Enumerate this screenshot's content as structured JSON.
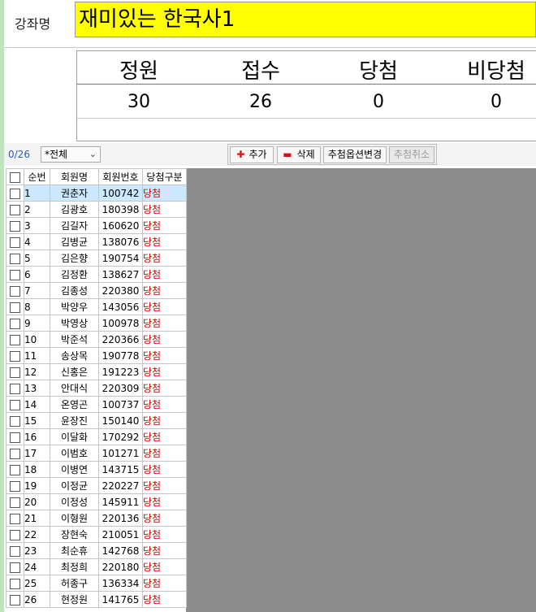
{
  "header": {
    "course_label": "강좌명",
    "course_name": "재미있는 한국사1"
  },
  "stats": {
    "headers": [
      "정원",
      "접수",
      "당첨",
      "비당첨"
    ],
    "values": [
      "30",
      "26",
      "0",
      "0"
    ]
  },
  "toolbar": {
    "count": "0/26",
    "filter_value": "*전체",
    "add_label": "추가",
    "delete_label": "삭제",
    "option_change_label": "추첨옵션변경",
    "cancel_label": "추첨취소"
  },
  "grid": {
    "columns": [
      "순번",
      "회원명",
      "회원번호",
      "당첨구분"
    ],
    "rows": [
      {
        "no": "1",
        "name": "권춘자",
        "id": "100742",
        "status": "당첨"
      },
      {
        "no": "2",
        "name": "김광호",
        "id": "180398",
        "status": "당첨"
      },
      {
        "no": "3",
        "name": "김길자",
        "id": "160620",
        "status": "당첨"
      },
      {
        "no": "4",
        "name": "김병균",
        "id": "138076",
        "status": "당첨"
      },
      {
        "no": "5",
        "name": "김은향",
        "id": "190754",
        "status": "당첨"
      },
      {
        "no": "6",
        "name": "김정환",
        "id": "138627",
        "status": "당첨"
      },
      {
        "no": "7",
        "name": "김종성",
        "id": "220380",
        "status": "당첨"
      },
      {
        "no": "8",
        "name": "박양우",
        "id": "143056",
        "status": "당첨"
      },
      {
        "no": "9",
        "name": "박영상",
        "id": "100978",
        "status": "당첨"
      },
      {
        "no": "10",
        "name": "박준석",
        "id": "220366",
        "status": "당첨"
      },
      {
        "no": "11",
        "name": "송상목",
        "id": "190778",
        "status": "당첨"
      },
      {
        "no": "12",
        "name": "신홍은",
        "id": "191223",
        "status": "당첨"
      },
      {
        "no": "13",
        "name": "안대식",
        "id": "220309",
        "status": "당첨"
      },
      {
        "no": "14",
        "name": "온영곤",
        "id": "100737",
        "status": "당첨"
      },
      {
        "no": "15",
        "name": "윤장진",
        "id": "150140",
        "status": "당첨"
      },
      {
        "no": "16",
        "name": "이달화",
        "id": "170292",
        "status": "당첨"
      },
      {
        "no": "17",
        "name": "이범호",
        "id": "101271",
        "status": "당첨"
      },
      {
        "no": "18",
        "name": "이병연",
        "id": "143715",
        "status": "당첨"
      },
      {
        "no": "19",
        "name": "이정균",
        "id": "220227",
        "status": "당첨"
      },
      {
        "no": "20",
        "name": "이정성",
        "id": "145911",
        "status": "당첨"
      },
      {
        "no": "21",
        "name": "이형원",
        "id": "220136",
        "status": "당첨"
      },
      {
        "no": "22",
        "name": "장현숙",
        "id": "210051",
        "status": "당첨"
      },
      {
        "no": "23",
        "name": "최순휴",
        "id": "142768",
        "status": "당첨"
      },
      {
        "no": "24",
        "name": "최정희",
        "id": "220180",
        "status": "당첨"
      },
      {
        "no": "25",
        "name": "허종구",
        "id": "136334",
        "status": "당첨"
      },
      {
        "no": "26",
        "name": "현정원",
        "id": "141765",
        "status": "당첨"
      }
    ]
  },
  "colors": {
    "course_bg": "#ffff00",
    "status_text": "#d40000",
    "selected_row": "#cce8ff",
    "empty_grid": "#8c8c8c"
  }
}
